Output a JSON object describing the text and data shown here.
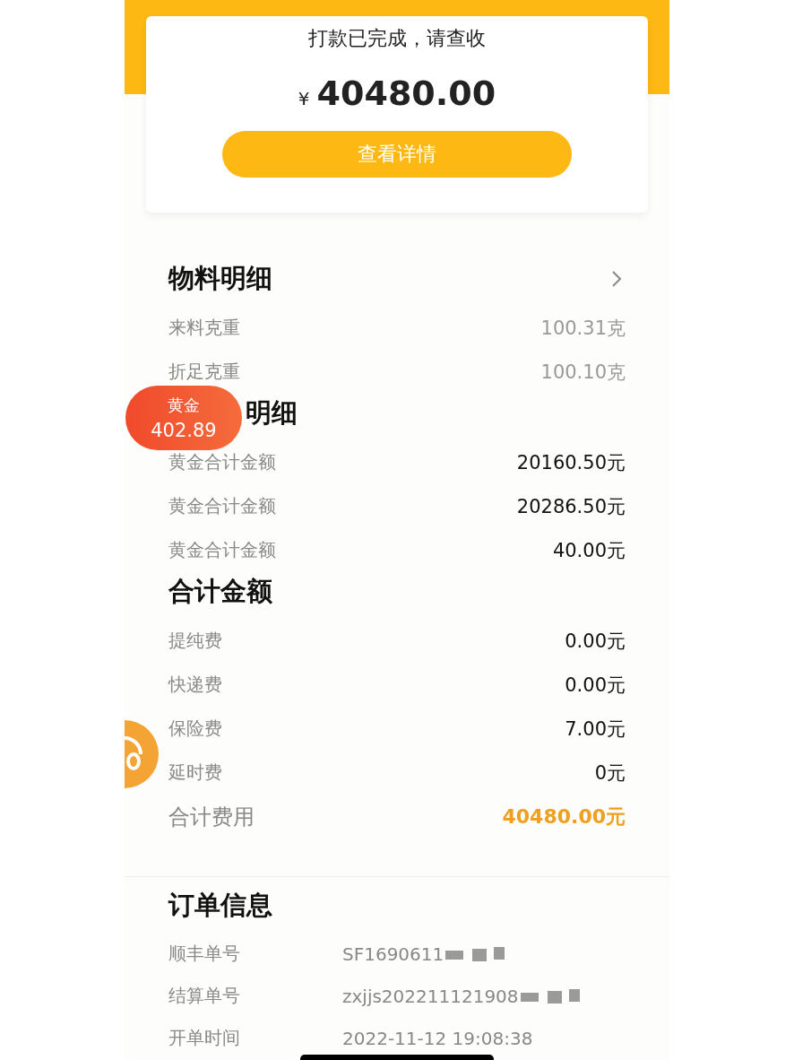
{
  "header": {
    "status": "打款已完成，请查收",
    "currency": "¥",
    "amount": "40480.00",
    "button": "查看详情"
  },
  "sections": [
    {
      "title": "物料明细",
      "chevron": true,
      "kind": "muted",
      "rows": [
        {
          "label": "来料克重",
          "value": "100.31克"
        },
        {
          "label": "折足克重",
          "value": "100.10克"
        }
      ]
    },
    {
      "title": "明细",
      "chevron": false,
      "covered": true,
      "kind": "normal",
      "rows": [
        {
          "label": "黄金合计金额",
          "value": "20160.50元"
        },
        {
          "label": "黄金合计金额",
          "value": "20286.50元"
        },
        {
          "label": "黄金合计金额",
          "value": "40.00元"
        }
      ]
    },
    {
      "title": "合计金额",
      "chevron": false,
      "kind": "normal",
      "rows": [
        {
          "label": "提纯费",
          "value": "0.00元"
        },
        {
          "label": "快递费",
          "value": "0.00元"
        },
        {
          "label": "保险费",
          "value": "7.00元"
        },
        {
          "label": "延时费",
          "value": "0元"
        }
      ],
      "total": {
        "label": "合计费用",
        "value": "40480.00元"
      }
    }
  ],
  "float_badge": {
    "label": "黄金",
    "value": "402.89"
  },
  "order": {
    "title": "订单信息",
    "rows": [
      {
        "label": "顺丰单号",
        "value": "SF1690611",
        "redacted": true
      },
      {
        "label": "结算单号",
        "value": "zxjjs202211121908",
        "redacted": true
      },
      {
        "label": "开单时间",
        "value": "2022-11-12 19:08:38",
        "redacted": false
      }
    ]
  }
}
